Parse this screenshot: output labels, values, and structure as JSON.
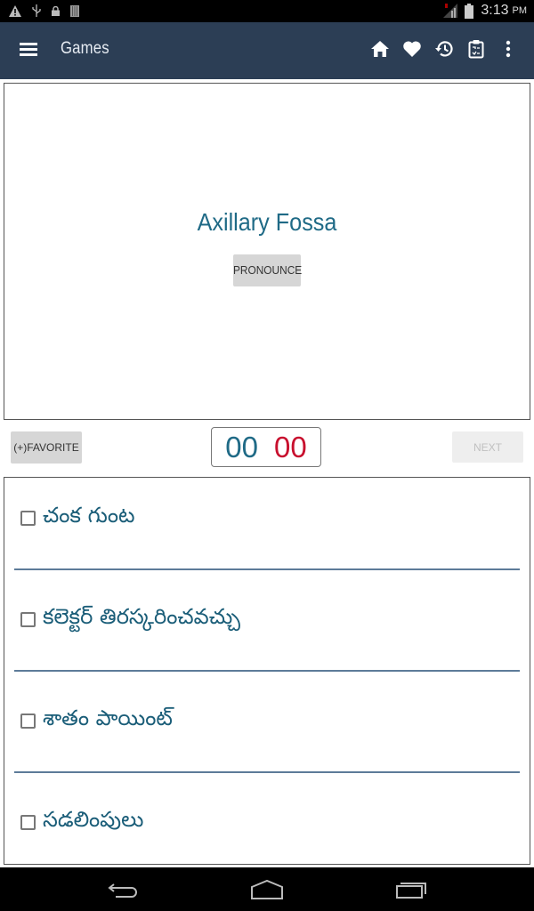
{
  "status_bar": {
    "time": "3:13",
    "ampm": "PM",
    "left_icons": [
      "warning-icon",
      "usb-icon",
      "lock-icon",
      "sd-card-icon"
    ],
    "right_icons": [
      "signal-icon",
      "battery-icon"
    ]
  },
  "app_bar": {
    "title": "Games",
    "menu_icon": "hamburger-menu-icon",
    "actions": [
      {
        "name": "home",
        "icon": "home-icon"
      },
      {
        "name": "favorites",
        "icon": "heart-icon"
      },
      {
        "name": "history",
        "icon": "history-icon"
      },
      {
        "name": "quiz",
        "icon": "clipboard-icon"
      },
      {
        "name": "more",
        "icon": "more-vertical-icon"
      }
    ]
  },
  "card": {
    "term": "Axillary Fossa",
    "pronounce_label": "PRONOUNCE"
  },
  "controls": {
    "favorite_label": "(+)FAVORITE",
    "timer_minutes": "00",
    "timer_seconds": "00",
    "next_label": "NEXT",
    "next_enabled": false
  },
  "answers": [
    {
      "label": "చంక గుంట",
      "checked": false
    },
    {
      "label": "కలెక్టర్ తిరస్కరించవచ్చు",
      "checked": false
    },
    {
      "label": "శాతం పాయింట్",
      "checked": false
    },
    {
      "label": "సడలింపులు",
      "checked": false
    }
  ],
  "colors": {
    "app_bar": "#2c3e55",
    "term_text": "#1f6a86",
    "timer_minutes": "#1f6a86",
    "timer_seconds": "#c8102e",
    "answer_text": "#1a5d78",
    "divider": "#5d7b99"
  },
  "nav_bar": {
    "buttons": [
      "back-icon",
      "home-outline-icon",
      "recent-apps-icon"
    ]
  }
}
